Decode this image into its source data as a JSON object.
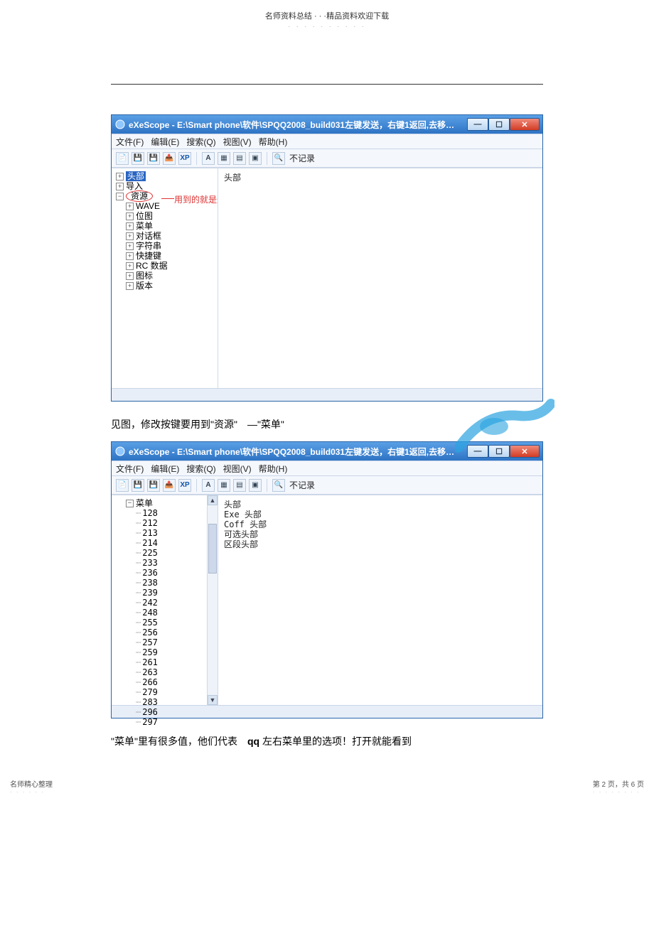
{
  "doc_header": {
    "title": "名师资料总结 · · ·精品资料欢迎下载",
    "dots": "· · · · · · · · · ·"
  },
  "window1": {
    "title": "eXeScope - E:\\Smart phone\\软件\\SPQQ2008_build031左键发送，右键1返回,去移动在线，...",
    "menus": {
      "file": "文件(F)",
      "edit": "编辑(E)",
      "search": "搜索(Q)",
      "view": "视图(V)",
      "help": "帮助(H)"
    },
    "toolbar_label": "不记录",
    "tree": {
      "n_header": "头部",
      "n_import": "导入",
      "n_res": "资源",
      "children": [
        "WAVE",
        "位图",
        "菜单",
        "对话框",
        "字符串",
        "快捷键",
        "RC 数据",
        "图标",
        "版本"
      ]
    },
    "annotation": "用到的就是这个选项",
    "right": {
      "line1": "头部"
    }
  },
  "caption1": "见图，修改按键要用到\"资源\"　—\"菜单\"",
  "window2": {
    "title": "eXeScope - E:\\Smart phone\\软件\\SPQQ2008_build031左键发送，右键1返回,去移动在线，...",
    "menus": {
      "file": "文件(F)",
      "edit": "编辑(E)",
      "search": "搜索(Q)",
      "view": "视图(V)",
      "help": "帮助(H)"
    },
    "toolbar_label": "不记录",
    "tree": {
      "root": "菜单",
      "items": [
        "128",
        "212",
        "213",
        "214",
        "225",
        "233",
        "236",
        "238",
        "239",
        "242",
        "248",
        "255",
        "256",
        "257",
        "259",
        "261",
        "263",
        "266",
        "279",
        "283",
        "296",
        "297"
      ]
    },
    "right": {
      "l1": "头部",
      "l2": "Exe 头部",
      "l3": "Coff 头部",
      "l4": "可选头部",
      "l5": "区段头部"
    }
  },
  "caption2": {
    "pre": "\"菜单\"里有很多值，他们代表　",
    "bold": "qq",
    "post": " 左右菜单里的选项！打开就能看到"
  },
  "footer": {
    "left": "名师精心整理",
    "right": "第 2 页，共 6 页"
  }
}
